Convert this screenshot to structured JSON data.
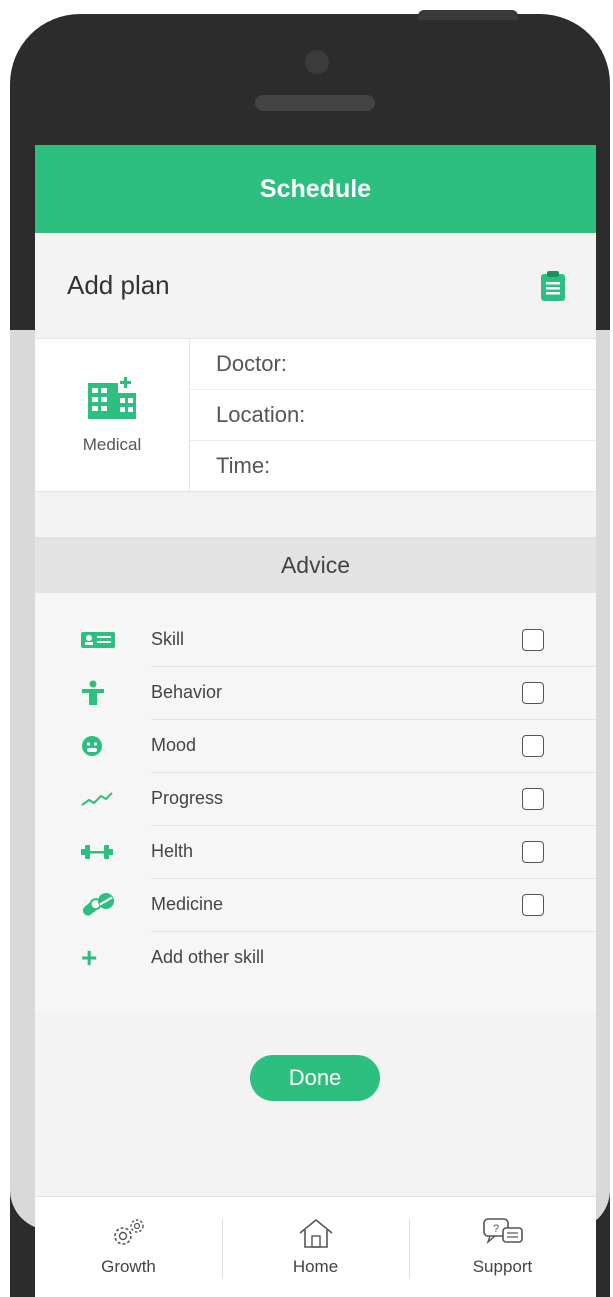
{
  "header": {
    "title": "Schedule"
  },
  "add_plan": {
    "title": "Add plan",
    "icon": "clipboard-icon"
  },
  "medical": {
    "label": "Medical",
    "icon": "hospital-icon",
    "fields": {
      "doctor": "Doctor:",
      "location": "Location:",
      "time": "Time:"
    }
  },
  "advice": {
    "title": "Advice",
    "items": [
      {
        "label": "Skill",
        "icon": "id-card-icon"
      },
      {
        "label": "Behavior",
        "icon": "person-icon"
      },
      {
        "label": "Mood",
        "icon": "face-icon"
      },
      {
        "label": "Progress",
        "icon": "trend-line-icon"
      },
      {
        "label": "Helth",
        "icon": "dumbbell-icon"
      },
      {
        "label": "Medicine",
        "icon": "pill-icon"
      }
    ],
    "add_other": "Add other skill"
  },
  "done_label": "Done",
  "tabs": [
    {
      "label": "Growth",
      "icon": "gears-icon"
    },
    {
      "label": "Home",
      "icon": "home-icon"
    },
    {
      "label": "Support",
      "icon": "chat-icon"
    }
  ],
  "colors": {
    "accent": "#2dbf80",
    "bezel": "#2c2c2c"
  }
}
